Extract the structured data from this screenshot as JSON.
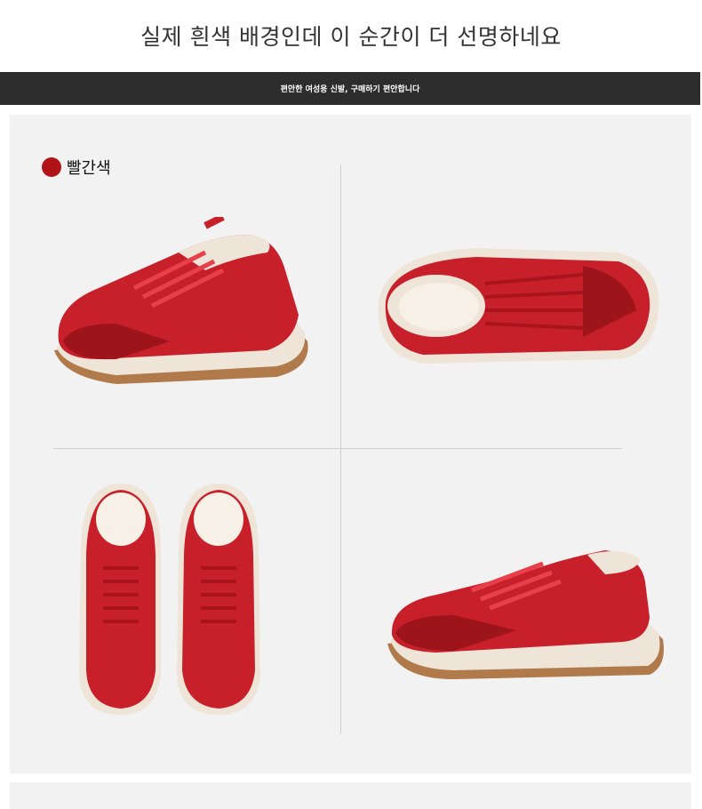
{
  "headline": "실제 흰색 배경인데 이 순간이 더 선명하네요",
  "banner": "편안한 여성용 신발, 구매하기 편안합니다",
  "color_option": {
    "label": "빨간색",
    "swatch": "#b11318"
  },
  "colors": {
    "panel_bg": "#f2f2f2",
    "banner_bg": "#2d2d2d",
    "shoe_red": "#c8202a",
    "shoe_dark": "#9e141b",
    "sole_cream": "#efe4d8",
    "outsole_gum": "#b07a4a"
  }
}
